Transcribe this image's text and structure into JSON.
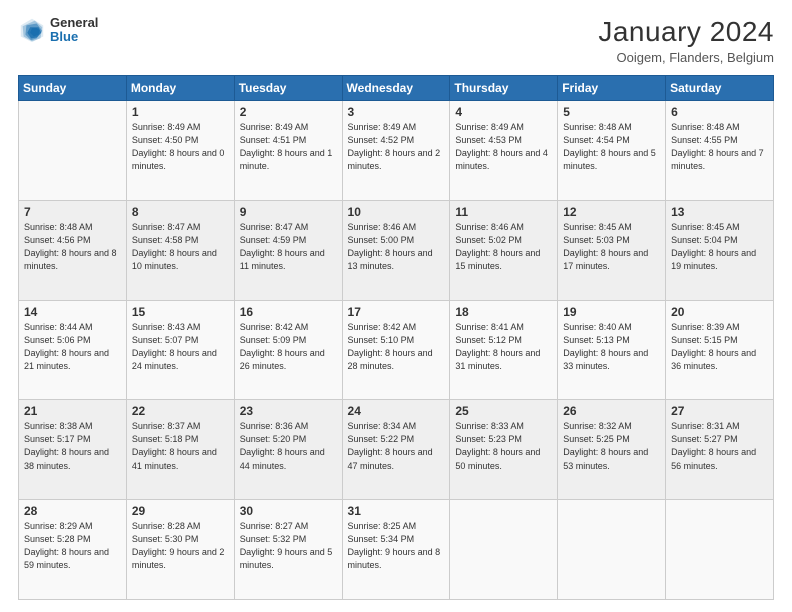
{
  "header": {
    "logo_general": "General",
    "logo_blue": "Blue",
    "main_title": "January 2024",
    "subtitle": "Ooigem, Flanders, Belgium"
  },
  "weekdays": [
    "Sunday",
    "Monday",
    "Tuesday",
    "Wednesday",
    "Thursday",
    "Friday",
    "Saturday"
  ],
  "weeks": [
    [
      {
        "day": "",
        "detail": ""
      },
      {
        "day": "1",
        "detail": "Sunrise: 8:49 AM\nSunset: 4:50 PM\nDaylight: 8 hours\nand 0 minutes."
      },
      {
        "day": "2",
        "detail": "Sunrise: 8:49 AM\nSunset: 4:51 PM\nDaylight: 8 hours\nand 1 minute."
      },
      {
        "day": "3",
        "detail": "Sunrise: 8:49 AM\nSunset: 4:52 PM\nDaylight: 8 hours\nand 2 minutes."
      },
      {
        "day": "4",
        "detail": "Sunrise: 8:49 AM\nSunset: 4:53 PM\nDaylight: 8 hours\nand 4 minutes."
      },
      {
        "day": "5",
        "detail": "Sunrise: 8:48 AM\nSunset: 4:54 PM\nDaylight: 8 hours\nand 5 minutes."
      },
      {
        "day": "6",
        "detail": "Sunrise: 8:48 AM\nSunset: 4:55 PM\nDaylight: 8 hours\nand 7 minutes."
      }
    ],
    [
      {
        "day": "7",
        "detail": "Sunrise: 8:48 AM\nSunset: 4:56 PM\nDaylight: 8 hours\nand 8 minutes."
      },
      {
        "day": "8",
        "detail": "Sunrise: 8:47 AM\nSunset: 4:58 PM\nDaylight: 8 hours\nand 10 minutes."
      },
      {
        "day": "9",
        "detail": "Sunrise: 8:47 AM\nSunset: 4:59 PM\nDaylight: 8 hours\nand 11 minutes."
      },
      {
        "day": "10",
        "detail": "Sunrise: 8:46 AM\nSunset: 5:00 PM\nDaylight: 8 hours\nand 13 minutes."
      },
      {
        "day": "11",
        "detail": "Sunrise: 8:46 AM\nSunset: 5:02 PM\nDaylight: 8 hours\nand 15 minutes."
      },
      {
        "day": "12",
        "detail": "Sunrise: 8:45 AM\nSunset: 5:03 PM\nDaylight: 8 hours\nand 17 minutes."
      },
      {
        "day": "13",
        "detail": "Sunrise: 8:45 AM\nSunset: 5:04 PM\nDaylight: 8 hours\nand 19 minutes."
      }
    ],
    [
      {
        "day": "14",
        "detail": "Sunrise: 8:44 AM\nSunset: 5:06 PM\nDaylight: 8 hours\nand 21 minutes."
      },
      {
        "day": "15",
        "detail": "Sunrise: 8:43 AM\nSunset: 5:07 PM\nDaylight: 8 hours\nand 24 minutes."
      },
      {
        "day": "16",
        "detail": "Sunrise: 8:42 AM\nSunset: 5:09 PM\nDaylight: 8 hours\nand 26 minutes."
      },
      {
        "day": "17",
        "detail": "Sunrise: 8:42 AM\nSunset: 5:10 PM\nDaylight: 8 hours\nand 28 minutes."
      },
      {
        "day": "18",
        "detail": "Sunrise: 8:41 AM\nSunset: 5:12 PM\nDaylight: 8 hours\nand 31 minutes."
      },
      {
        "day": "19",
        "detail": "Sunrise: 8:40 AM\nSunset: 5:13 PM\nDaylight: 8 hours\nand 33 minutes."
      },
      {
        "day": "20",
        "detail": "Sunrise: 8:39 AM\nSunset: 5:15 PM\nDaylight: 8 hours\nand 36 minutes."
      }
    ],
    [
      {
        "day": "21",
        "detail": "Sunrise: 8:38 AM\nSunset: 5:17 PM\nDaylight: 8 hours\nand 38 minutes."
      },
      {
        "day": "22",
        "detail": "Sunrise: 8:37 AM\nSunset: 5:18 PM\nDaylight: 8 hours\nand 41 minutes."
      },
      {
        "day": "23",
        "detail": "Sunrise: 8:36 AM\nSunset: 5:20 PM\nDaylight: 8 hours\nand 44 minutes."
      },
      {
        "day": "24",
        "detail": "Sunrise: 8:34 AM\nSunset: 5:22 PM\nDaylight: 8 hours\nand 47 minutes."
      },
      {
        "day": "25",
        "detail": "Sunrise: 8:33 AM\nSunset: 5:23 PM\nDaylight: 8 hours\nand 50 minutes."
      },
      {
        "day": "26",
        "detail": "Sunrise: 8:32 AM\nSunset: 5:25 PM\nDaylight: 8 hours\nand 53 minutes."
      },
      {
        "day": "27",
        "detail": "Sunrise: 8:31 AM\nSunset: 5:27 PM\nDaylight: 8 hours\nand 56 minutes."
      }
    ],
    [
      {
        "day": "28",
        "detail": "Sunrise: 8:29 AM\nSunset: 5:28 PM\nDaylight: 8 hours\nand 59 minutes."
      },
      {
        "day": "29",
        "detail": "Sunrise: 8:28 AM\nSunset: 5:30 PM\nDaylight: 9 hours\nand 2 minutes."
      },
      {
        "day": "30",
        "detail": "Sunrise: 8:27 AM\nSunset: 5:32 PM\nDaylight: 9 hours\nand 5 minutes."
      },
      {
        "day": "31",
        "detail": "Sunrise: 8:25 AM\nSunset: 5:34 PM\nDaylight: 9 hours\nand 8 minutes."
      },
      {
        "day": "",
        "detail": ""
      },
      {
        "day": "",
        "detail": ""
      },
      {
        "day": "",
        "detail": ""
      }
    ]
  ]
}
